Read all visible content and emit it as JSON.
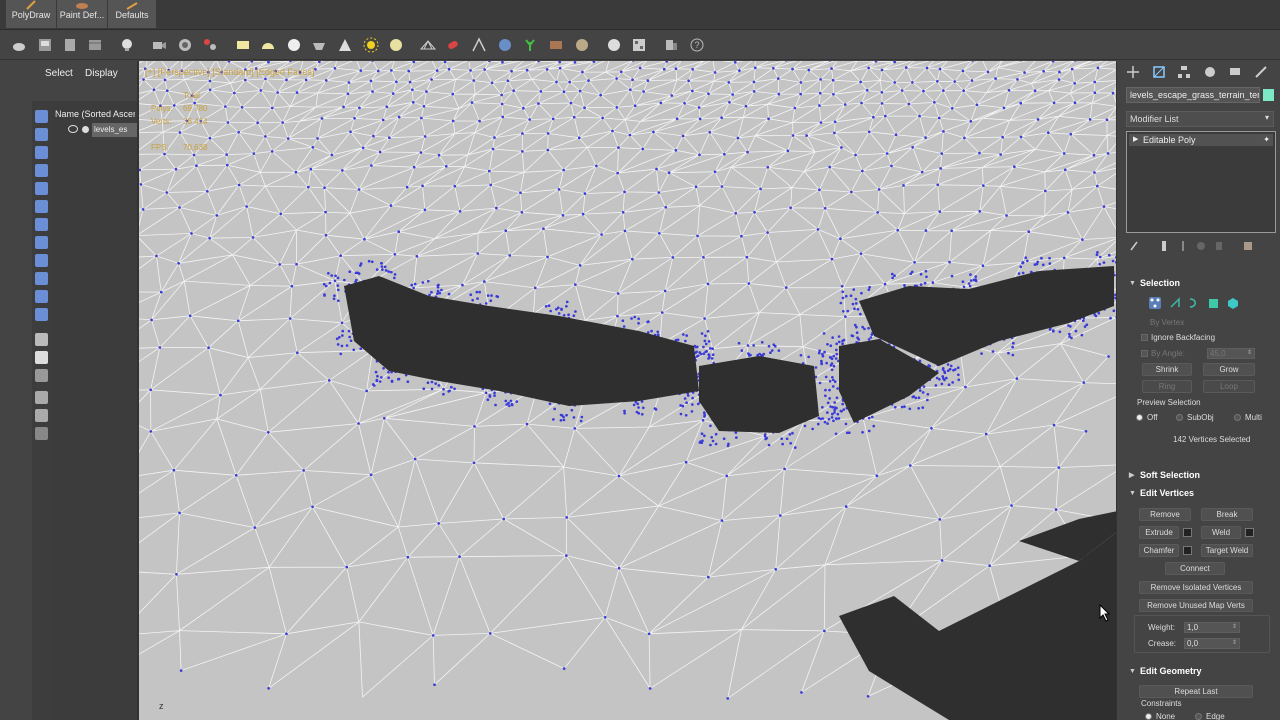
{
  "ribbon": {
    "buttons": [
      {
        "label": "PolyDraw",
        "icon": "polydraw-icon"
      },
      {
        "label": "Paint Def...",
        "icon": "paint-deform-icon"
      },
      {
        "label": "Defaults",
        "icon": "defaults-icon"
      }
    ]
  },
  "scene_explorer": {
    "tabs": [
      "Select",
      "Display"
    ],
    "column_header": "Name (Sorted Ascen",
    "object_name": "levels_es"
  },
  "viewport": {
    "label": "[+] [Perspective] [Standard] [Edged Faces]",
    "stats": {
      "total_label": "Total",
      "polys_label": "Polys:",
      "polys_value": "69 780",
      "verts_label": "Verts:",
      "verts_value": "36 414",
      "fps_label": "FPS:",
      "fps_value": "70,638"
    },
    "axis_label": "z"
  },
  "command_panel": {
    "object_name": "levels_escape_grass_terrain_terr",
    "object_color": "#7de8c6",
    "modifier_list": "Modifier List",
    "stack_item": "Editable Poly",
    "selection": {
      "title": "Selection",
      "by_vertex": "By Vertex",
      "ignore_backfacing": "Ignore Backfacing",
      "by_angle_label": "By Angle:",
      "by_angle_value": "45,0",
      "shrink": "Shrink",
      "grow": "Grow",
      "ring": "Ring",
      "loop": "Loop",
      "preview_title": "Preview Selection",
      "preview_off": "Off",
      "preview_subobj": "SubObj",
      "preview_multi": "Multi",
      "status": "142 Vertices Selected"
    },
    "soft_selection": {
      "title": "Soft Selection"
    },
    "edit_vertices": {
      "title": "Edit Vertices",
      "remove": "Remove",
      "break": "Break",
      "extrude": "Extrude",
      "weld": "Weld",
      "chamfer": "Chamfer",
      "target_weld": "Target Weld",
      "connect": "Connect",
      "remove_isolated": "Remove Isolated Vertices",
      "remove_unused": "Remove Unused Map Verts",
      "weight_label": "Weight:",
      "weight_value": "1,0",
      "crease_label": "Crease:",
      "crease_value": "0,0"
    },
    "edit_geometry": {
      "title": "Edit Geometry",
      "repeat_last": "Repeat Last",
      "constraints": "Constraints",
      "none": "None",
      "edge": "Edge"
    }
  }
}
